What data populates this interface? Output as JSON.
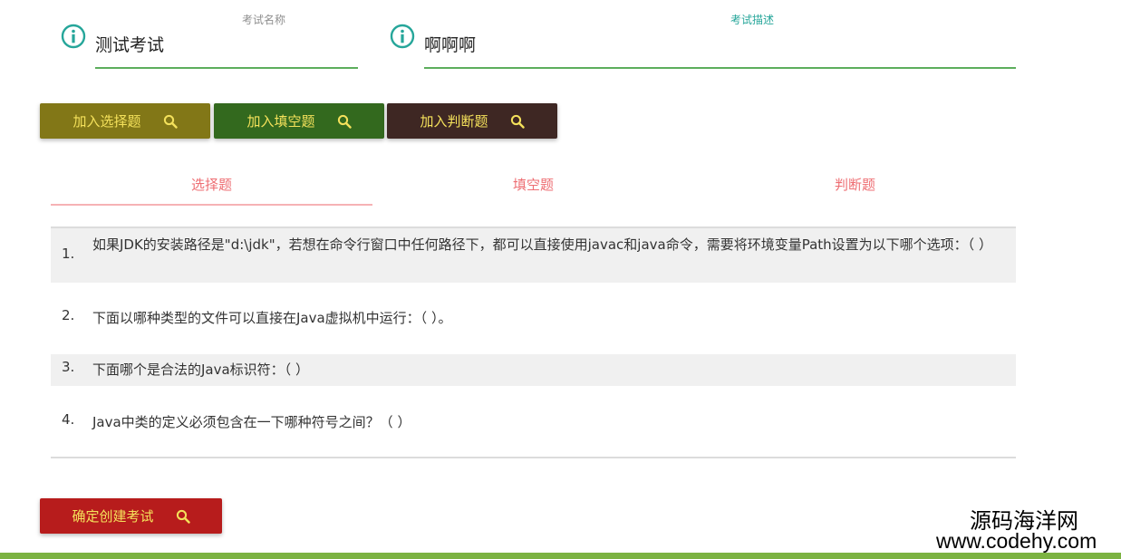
{
  "form": {
    "name_field": {
      "label": "考试名称",
      "value": "测试考试"
    },
    "desc_field": {
      "label": "考试描述",
      "value": "啊啊啊"
    }
  },
  "add_buttons": {
    "choice": "加入选择题",
    "fill": "加入填空题",
    "judge": "加入判断题"
  },
  "tabs": [
    {
      "label": "选择题",
      "active": true
    },
    {
      "label": "填空题",
      "active": false
    },
    {
      "label": "判断题",
      "active": false
    }
  ],
  "questions": [
    {
      "num": "1.",
      "text": "如果JDK的安装路径是\"d:\\jdk\"，若想在命令行窗口中任何路径下，都可以直接使用javac和java命令，需要将环境变量Path设置为以下哪个选项：（ ）"
    },
    {
      "num": "2.",
      "text": "下面以哪种类型的文件可以直接在Java虚拟机中运行：（ ）。"
    },
    {
      "num": "3.",
      "text": "下面哪个是合法的Java标识符：（ ）"
    },
    {
      "num": "4.",
      "text": "Java中类的定义必须包含在一下哪种符号之间？（ ）"
    }
  ],
  "submit_label": "确定创建考试",
  "watermark": {
    "cn": "源码海洋网",
    "en": "www.codehy.com"
  },
  "icons": {
    "field_icon": "info-icon",
    "button_icon": "search-icon"
  },
  "colors": {
    "accent_green": "#5cae5c",
    "teal": "#26a69a",
    "tab_red": "#ee6e73",
    "btn_olive": "#827717",
    "btn_green": "#33691e",
    "btn_brown": "#3e2723",
    "btn_red": "#b71c1c",
    "btn_text": "#f4e15b"
  }
}
